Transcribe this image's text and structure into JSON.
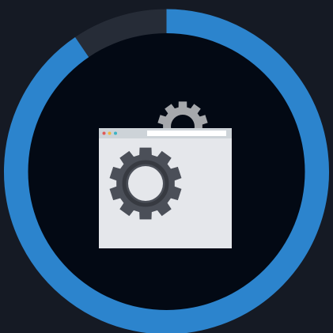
{
  "progress_ring": {
    "progress_fraction": 0.905,
    "fill_color": "#2c84cd",
    "track_color": "#262c37",
    "inner_color": "#030914",
    "background_color": "#151a24"
  },
  "illustration": {
    "icon_name": "browser-window-settings-icon",
    "window_color": "#e5e7eb",
    "titlebar_color": "#cdd3d8",
    "address_bar_color": "#ffffff",
    "window_dots": [
      "#e05a57",
      "#f2b63d",
      "#3bb3c3"
    ],
    "large_gear": {
      "icon_name": "gear-icon",
      "color": "#4b4f58",
      "inner_ring_color": "#373a41"
    },
    "small_gear": {
      "icon_name": "gear-icon",
      "color": "#a6a8ac"
    }
  }
}
